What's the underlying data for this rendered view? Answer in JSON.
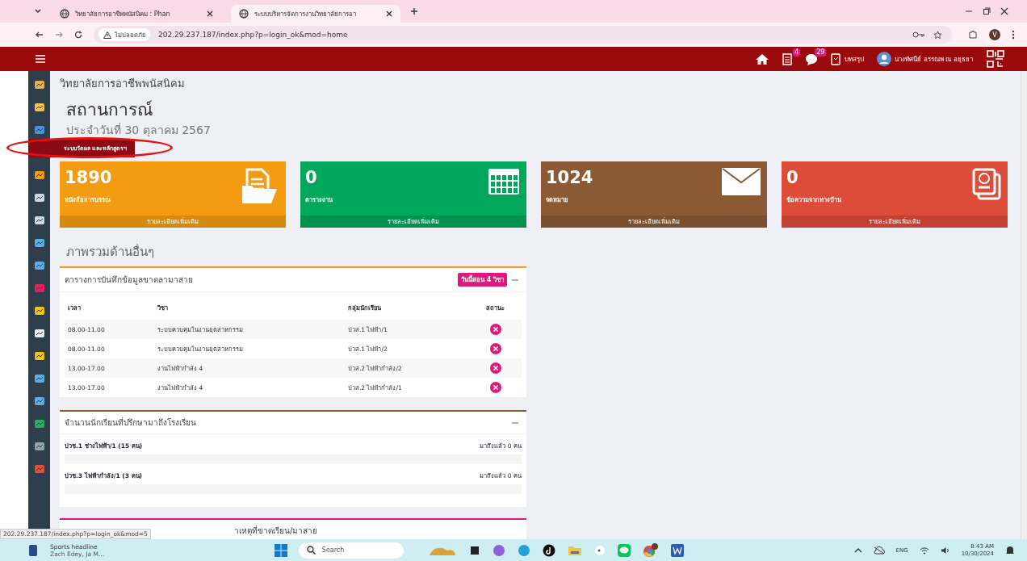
{
  "browser": {
    "tabs": [
      {
        "title": "วิทยาลัยการอาชีพพนัสนิคม : Phan",
        "selected": false
      },
      {
        "title": "ระบบบริหารจัดการงานวิทยาลัยการอา",
        "selected": true
      }
    ],
    "security": "ไม่ปลอดภัย",
    "url": "202.29.237.187/index.php?p=login_ok&mod=home",
    "profile": "V"
  },
  "topbar": {
    "docs_badge": "4",
    "chat_badge": "29",
    "summary": "บทสรุป",
    "user": "นางทัศนีย์ อรรณพ ณ อยุธยา"
  },
  "sidebar_tooltip": "ระบบวัดผล และหลักสูตรฯ",
  "page": {
    "college": "วิทยาลัยการอาชีพพนัสนิคม",
    "title": "สถานการณ์",
    "date": "ประจำวันที่ 30 ตุลาคม 2567"
  },
  "cards": [
    {
      "kind": "docs",
      "value": "1890",
      "label": "หนังสือสารบรรณ",
      "more": "รายละเอียดเพิ่มเติม",
      "color": "#f39c12"
    },
    {
      "kind": "calendar",
      "value": "0",
      "label": "ตารางงาน",
      "more": "รายละเอียดเพิ่มเติม",
      "color": "#00a65a"
    },
    {
      "kind": "mail",
      "value": "1024",
      "label": "จดหมาย",
      "more": "รายละเอียดเพิ่มเติม",
      "color": "#8b5a35"
    },
    {
      "kind": "grades",
      "value": "0",
      "label": "ข้อความจากทางบ้าน",
      "more": "รายละเอียดเพิ่มเติม",
      "color": "#dd4b39"
    }
  ],
  "overview_title": "ภาพรวมด้านอื่นๆ",
  "attendance": {
    "title": "ตารางการบันทึกข้อมูลขาดลามาสาย",
    "badge": "วันนี้สอน 4 วิชา",
    "columns": [
      "เวลา",
      "วิชา",
      "กลุ่มนักเรียน",
      "สถานะ"
    ],
    "rows": [
      {
        "time": "08.00-11.00",
        "subject": "ระบบควบคุมในงานอุตสาหกรรม",
        "group": "ปวส.1 ไฟฟ้า/1",
        "recorded": false
      },
      {
        "time": "08.00-11.00",
        "subject": "ระบบควบคุมในงานอุตสาหกรรม",
        "group": "ปวส.1 ไฟฟ้า/2",
        "recorded": false
      },
      {
        "time": "13.00-17.00",
        "subject": "งานไฟฟ้ากำลัง 4",
        "group": "ปวส.2 ไฟฟ้ากำลัง/2",
        "recorded": false
      },
      {
        "time": "13.00-17.00",
        "subject": "งานไฟฟ้ากำลัง 4",
        "group": "ปวส.2 ไฟฟ้ากำลัง/1",
        "recorded": false
      }
    ]
  },
  "arrivals": {
    "title": "จำนวนนักเรียนที่ปรึกษามาถึงโรงเรียน",
    "items": [
      {
        "name": "ปวช.1 ช่างไฟฟ้า/1 (15 คน)",
        "arrived": "มาถึงแล้ว 0 คน",
        "level": 0
      },
      {
        "name": "ปวช.3 ไฟฟ้ากำลัง/1 (3 คน)",
        "arrived": "มาถึงแล้ว 0 คน",
        "level": 0
      }
    ]
  },
  "third_panel_title": "าเหตุที่ขาดเรียน/มาสาย",
  "status_url": "202.29.237.187/index.php?p=login_ok&mod=5",
  "taskbar": {
    "news_title": "Sports headline",
    "news_sub": "Zach Edey, Ja M...",
    "search": "Search",
    "lang": "ENG",
    "time": "8:43 AM",
    "date": "10/30/2024"
  }
}
